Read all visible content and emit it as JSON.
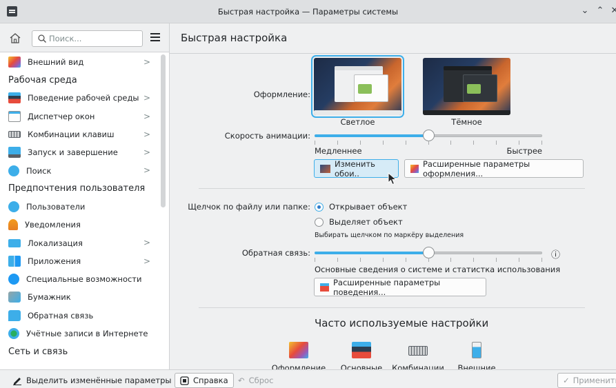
{
  "window": {
    "title": "Быстрая настройка — Параметры системы",
    "minimize_glyph": "⌄",
    "maximize_glyph": "⌃",
    "close_glyph": "✕"
  },
  "sidebar": {
    "search_placeholder": "Поиск...",
    "items": [
      {
        "label": "Внешний вид",
        "icon": "appearance-icon",
        "chevron": true,
        "type": "item"
      },
      {
        "label": "Рабочая среда",
        "type": "header"
      },
      {
        "label": "Поведение рабочей среды",
        "icon": "workspace-behavior-icon",
        "chevron": true,
        "type": "item"
      },
      {
        "label": "Диспетчер окон",
        "icon": "window-manager-icon",
        "chevron": true,
        "type": "item"
      },
      {
        "label": "Комбинации клавиш",
        "icon": "keyboard-icon",
        "chevron": true,
        "type": "item"
      },
      {
        "label": "Запуск и завершение",
        "icon": "startup-icon",
        "chevron": true,
        "type": "item"
      },
      {
        "label": "Поиск",
        "icon": "search-icon",
        "chevron": true,
        "type": "item"
      },
      {
        "label": "Предпочтения пользователя",
        "type": "header"
      },
      {
        "label": "Пользователи",
        "icon": "users-icon",
        "chevron": false,
        "type": "item"
      },
      {
        "label": "Уведомления",
        "icon": "notifications-icon",
        "chevron": false,
        "type": "item"
      },
      {
        "label": "Локализация",
        "icon": "localization-icon",
        "chevron": true,
        "type": "item"
      },
      {
        "label": "Приложения",
        "icon": "applications-icon",
        "chevron": true,
        "type": "item"
      },
      {
        "label": "Специальные возможности",
        "icon": "accessibility-icon",
        "chevron": false,
        "type": "item"
      },
      {
        "label": "Бумажник",
        "icon": "wallet-icon",
        "chevron": false,
        "type": "item"
      },
      {
        "label": "Обратная связь",
        "icon": "feedback-icon",
        "chevron": false,
        "type": "item"
      },
      {
        "label": "Учётные записи в Интернете",
        "icon": "online-accounts-icon",
        "chevron": false,
        "type": "item"
      },
      {
        "label": "Сеть и связь",
        "type": "header"
      }
    ]
  },
  "main": {
    "title": "Быстрая настройка",
    "theme_label": "Оформление:",
    "themes": [
      {
        "caption": "Светлое",
        "selected": true
      },
      {
        "caption": "Тёмное",
        "selected": false
      }
    ],
    "animation_label": "Скорость анимации:",
    "animation_slow": "Медленнее",
    "animation_fast": "Быстрее",
    "animation_value": 0.5,
    "change_wallpaper_button": "Изменить обои...",
    "change_wallpaper_display": "Изменить обои..",
    "advanced_appearance_button": "Расширенные параметры оформления...",
    "click_label": "Щелчок по файлу или папке:",
    "click_open": "Открывает объект",
    "click_select": "Выделяет объект",
    "click_hint": "Выбирать щелчком по маркёру выделения",
    "feedback_label": "Обратная связь:",
    "feedback_value": 0.5,
    "feedback_desc": "Основные сведения о системе и статистка использования",
    "info_glyph": "ⓘ",
    "advanced_behavior_button": "Расширенные параметры поведения...",
    "frequent_title": "Часто используемые настройки",
    "frequent": [
      {
        "label": "Оформление",
        "icon": "appearance-icon"
      },
      {
        "label": "Основные",
        "icon": "general-behavior-icon"
      },
      {
        "label": "Комбинации",
        "icon": "keyboard-icon"
      },
      {
        "label": "Внешние",
        "icon": "external-devices-icon"
      }
    ]
  },
  "footer": {
    "highlight_changed": "Выделить изменённые параметры",
    "help": "Справка",
    "reset": "Сброс",
    "apply": "Применить"
  }
}
